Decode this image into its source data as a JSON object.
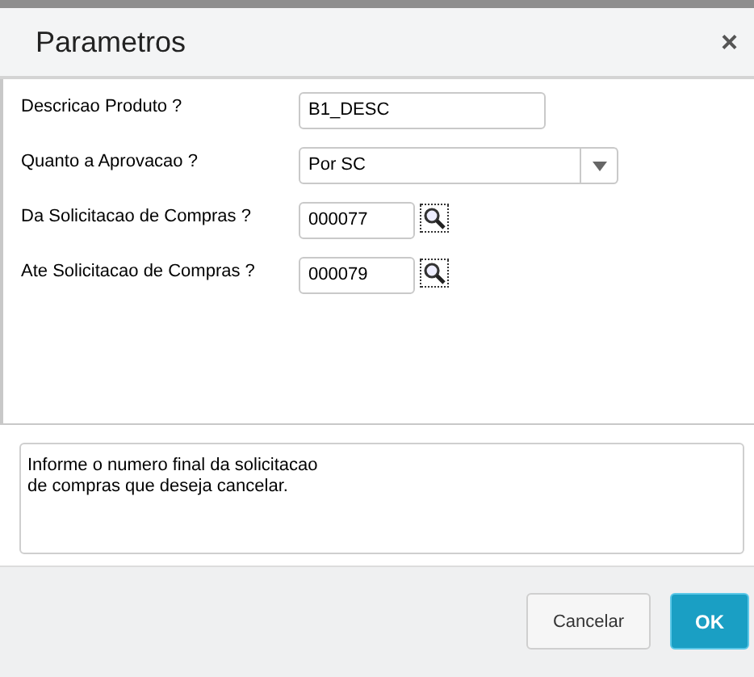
{
  "window": {
    "title": "Parametros",
    "close": "×"
  },
  "fields": [
    {
      "label": "Descricao Produto ?",
      "kind": "text",
      "value": "B1_DESC"
    },
    {
      "label": "Quanto a Aprovacao ?",
      "kind": "select",
      "value": "Por SC"
    },
    {
      "label": "Da Solicitacao de Compras ?",
      "kind": "lookup",
      "value": "000077"
    },
    {
      "label": "Ate Solicitacao de Compras ?",
      "kind": "lookup",
      "value": "000079"
    }
  ],
  "help": "Informe o numero final da solicitacao\nde compras que deseja cancelar.",
  "buttons": [
    {
      "label": "Cancelar",
      "kind": "secondary"
    },
    {
      "label": "OK",
      "kind": "primary"
    }
  ]
}
